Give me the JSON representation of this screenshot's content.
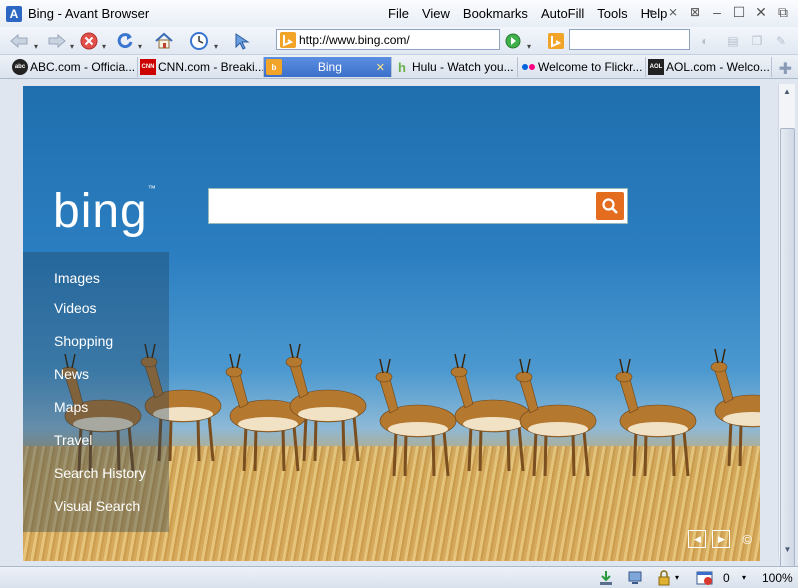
{
  "window": {
    "title": "Bing - Avant Browser",
    "app_icon_glyph": "A"
  },
  "menu": [
    "File",
    "View",
    "Bookmarks",
    "AutoFill",
    "Tools",
    "Help"
  ],
  "address_bar": {
    "url": "http://www.bing.com/"
  },
  "search_box": {
    "value": ""
  },
  "tabs": [
    {
      "label": "ABC.com - Officia...",
      "icon": "abc-favicon",
      "active": false
    },
    {
      "label": "CNN.com - Breaki...",
      "icon": "cnn-favicon",
      "active": false
    },
    {
      "label": "Bing",
      "icon": "bing-favicon",
      "active": true
    },
    {
      "label": "Hulu - Watch you...",
      "icon": "hulu-favicon",
      "active": false
    },
    {
      "label": "Welcome to Flickr...",
      "icon": "flickr-favicon",
      "active": false
    },
    {
      "label": "AOL.com - Welco...",
      "icon": "aol-favicon",
      "active": false
    }
  ],
  "bing": {
    "logo_text": "bing",
    "search_value": "",
    "nav": [
      "Images",
      "Videos",
      "Shopping",
      "News",
      "Maps",
      "Travel",
      "Search History",
      "Visual Search"
    ],
    "copyright": "©"
  },
  "status_bar": {
    "popup_count": "0",
    "zoom": "100%"
  },
  "colors": {
    "bing_search_button": "#e46c1e",
    "active_tab": "#3c6fc9",
    "sky_top": "#1f6fae"
  }
}
